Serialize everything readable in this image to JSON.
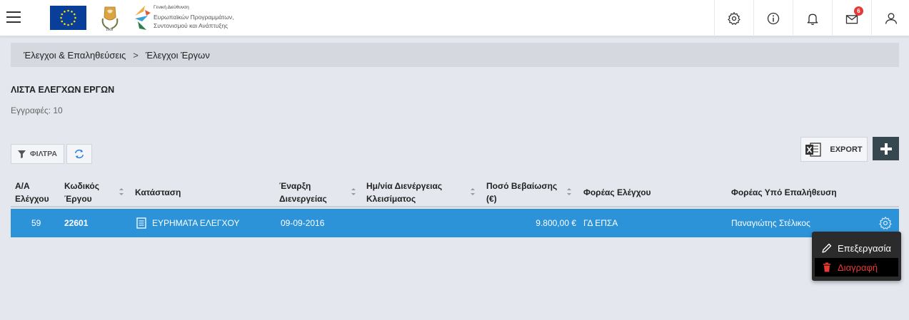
{
  "header": {
    "logo_lines": [
      "Γενική Διεύθυνση",
      "Ευρωπαϊκών Προγραμμάτων,",
      "Συντονισμού και Ανάπτυξης"
    ],
    "notification_badge": "6"
  },
  "breadcrumb": {
    "items": [
      "Έλεγχοι & Επαληθεύσεις",
      "Έλεγχοι Έργων"
    ],
    "separator": ">"
  },
  "page": {
    "title": "ΛΙΣΤΑ ΕΛΕΓΧΩΝ ΕΡΓΩΝ",
    "count": "Εγγραφές: 10"
  },
  "toolbar": {
    "filter_label": "ΦΙΛΤΡΑ",
    "export_label": "EXPORT"
  },
  "table": {
    "columns": [
      {
        "line1": "Α/Α",
        "line2": "Ελέγχου"
      },
      {
        "line1": "Κωδικός",
        "line2": "Έργου"
      },
      {
        "line1": "Κατάσταση",
        "line2": ""
      },
      {
        "line1": "Έναρξη",
        "line2": "Διενεργείας"
      },
      {
        "line1": "Ημ/νία Διενέργειας",
        "line2": "Κλεισίματος"
      },
      {
        "line1": "Ποσό Βεβαίωσης",
        "line2": "(€)"
      },
      {
        "line1": "Φορέας Ελέγχου",
        "line2": ""
      },
      {
        "line1": "Φορέας Υπό Επαλήθευση",
        "line2": ""
      }
    ],
    "rows": [
      {
        "aa": "59",
        "code": "22601",
        "status": "ΕΥΡΗΜΑΤΑ ΕΛΕΓΧΟΥ",
        "start": "09-09-2016",
        "close": "",
        "amount": "9.800,00 €",
        "control_body": "ΓΔ ΕΠΣΑ",
        "audited_body": "Παναγιώτης Στέλικος"
      }
    ]
  },
  "row_menu": {
    "edit_label": "Επεξεργασία",
    "delete_label": "Διαγραφή"
  },
  "colors": {
    "selected_row": "#2d93d8",
    "badge": "#e53935",
    "delete": "#e53935"
  }
}
